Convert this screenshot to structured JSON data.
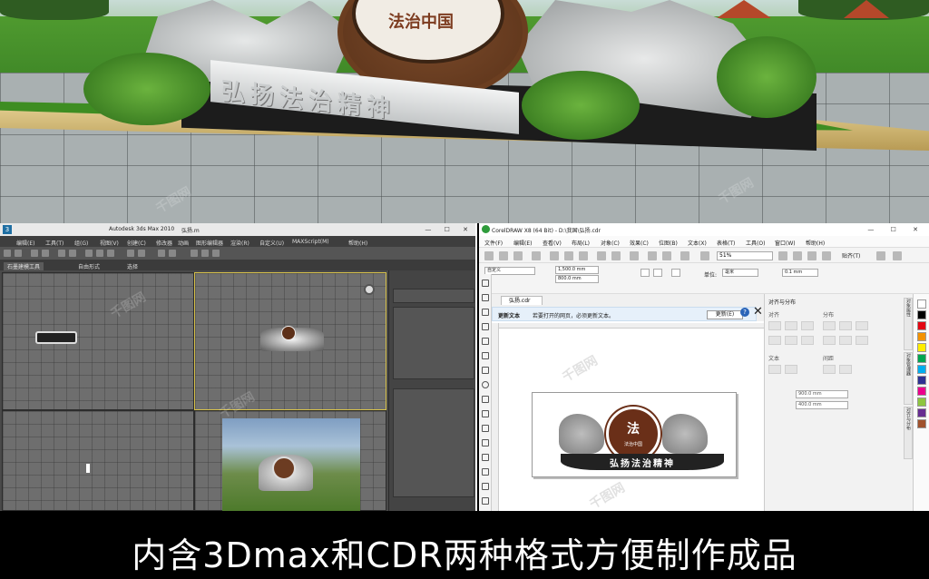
{
  "render": {
    "emblem_text": "法治中国",
    "letters_text": "弘扬法治精神"
  },
  "max": {
    "title": "Autodesk 3ds Max 2010",
    "filename": "弘扬.m",
    "menu": [
      "编辑(E)",
      "工具(T)",
      "组(G)",
      "视图(V)",
      "创建(C)",
      "修改器",
      "动画",
      "图形编辑器",
      "渲染(R)",
      "自定义(U)",
      "MAXScript(M)",
      "帮助(H)"
    ],
    "ribbon": [
      "石墨建模工具",
      "自由形式",
      "选择"
    ],
    "active_ribbon": "石墨建模工具"
  },
  "cdr": {
    "title": "CorelDRAW X8 (64 Bit) - D:\\我国\\弘扬.cdr",
    "menu": [
      "文件(F)",
      "编辑(E)",
      "查看(V)",
      "布局(L)",
      "对象(C)",
      "效果(C)",
      "位图(B)",
      "文本(X)",
      "表格(T)",
      "工具(O)",
      "窗口(W)",
      "帮助(H)"
    ],
    "zoom": "51%",
    "snap_label": "贴齐(T)",
    "page_size": "自定义",
    "width_value": "1,500.0 mm",
    "height_value": "800.0 mm",
    "units_label": "单位:",
    "units_value": "毫米",
    "nudge_value": "0.1 mm",
    "tab_name": "弘扬.cdr",
    "notice_title": "更新文本",
    "notice_message": "若要打开的网页，必须更新文本。",
    "notice_button": "更新(E)",
    "design_emblem_mark": "法",
    "design_emblem_text": "法治中国",
    "design_plaque_text": "弘扬法治精神",
    "docker_title": "对齐与分布",
    "docker_align": "对齐",
    "docker_distribute": "分布",
    "docker_text": "文本",
    "docker_spacing": "间距",
    "x_value": "900.0 mm",
    "y_value": "400.0 mm",
    "side_tabs": [
      "对象属性",
      "对象管理器",
      "对齐与分布"
    ],
    "palette": [
      "#ffffff",
      "#000000",
      "#e30613",
      "#f39200",
      "#ffed00",
      "#00a651",
      "#00aeef",
      "#2e3192",
      "#ec008c",
      "#8dc63f",
      "#662d91",
      "#a0522d"
    ]
  },
  "caption": "内含3Dmax和CDR两种格式方便制作成品",
  "watermark": "千图网"
}
